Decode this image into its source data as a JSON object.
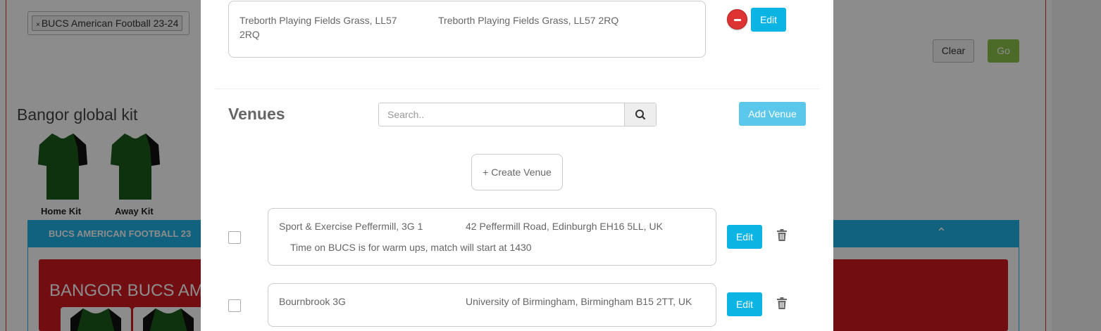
{
  "background": {
    "filter_tag": "BUCS American Football 23-24",
    "filter_tag_remove": "×",
    "clear_label": "Clear",
    "go_label": "Go",
    "kit_title": "Bangor global kit",
    "home_kit_label": "Home Kit",
    "away_kit_label": "Away Kit",
    "section_title": "BUCS AMERICAN FOOTBALL 23",
    "panel_title": "BANGOR BUCS AM",
    "kit_color": "#1a5c1a",
    "sleeve_color": "#111111",
    "accent_red": "#d01a21",
    "accent_blue": "#1fb3e6"
  },
  "modal": {
    "selected_venue": {
      "name": "Treborth Playing Fields Grass, LL57 2RQ",
      "address": "Treborth Playing Fields Grass, LL57 2RQ",
      "edit_label": "Edit"
    },
    "venues_title": "Venues",
    "search": {
      "placeholder": "Search.."
    },
    "add_venue_label": "Add Venue",
    "create_venue_label": "+ Create Venue",
    "venues": [
      {
        "name": "Sport & Exercise Peffermill, 3G 1",
        "address": "42 Peffermill Road, Edinburgh EH16 5LL, UK",
        "note": "Time on BUCS is for warm ups, match will start at 1430",
        "edit_label": "Edit"
      },
      {
        "name": "Bournbrook 3G",
        "address": "University of Birmingham, Birmingham B15 2TT, UK",
        "note": "",
        "edit_label": "Edit"
      }
    ]
  }
}
